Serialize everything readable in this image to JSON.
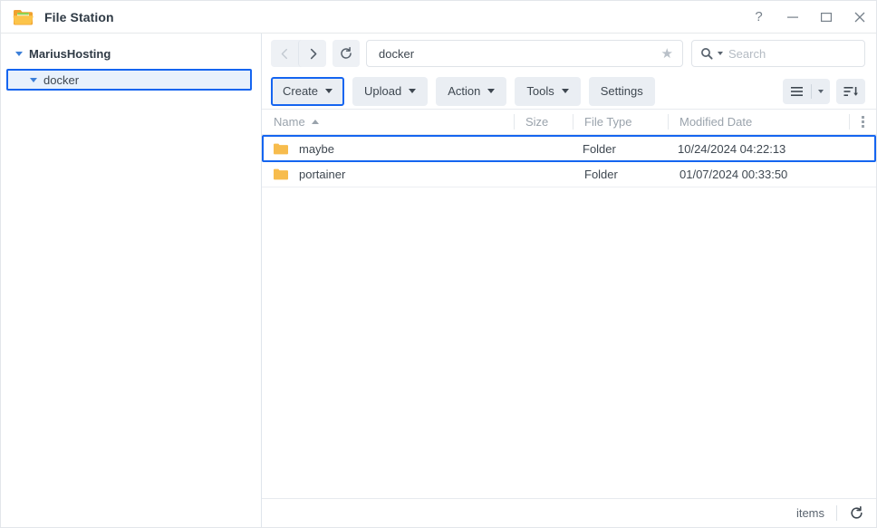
{
  "window": {
    "title": "File Station",
    "app_icon": "folder-icon",
    "controls": {
      "help": "?",
      "minimize": "minimize-icon",
      "maximize": "maximize-icon",
      "close": "close-icon"
    }
  },
  "sidebar": {
    "root": {
      "label": "MariusHosting",
      "expanded": true
    },
    "items": [
      {
        "label": "docker",
        "expanded": true,
        "selected": true
      }
    ]
  },
  "nav": {
    "back": "back-icon",
    "forward": "forward-icon",
    "refresh": "refresh-icon",
    "back_disabled": true,
    "address_value": "docker",
    "address_placeholder": "",
    "favorite_icon": "star-icon"
  },
  "search": {
    "placeholder": "Search",
    "value": "",
    "icon": "search-icon"
  },
  "toolbar": {
    "buttons": [
      {
        "label": "Create",
        "dropdown": true,
        "focused": true
      },
      {
        "label": "Upload",
        "dropdown": true,
        "focused": false
      },
      {
        "label": "Action",
        "dropdown": true,
        "focused": false
      },
      {
        "label": "Tools",
        "dropdown": true,
        "focused": false
      },
      {
        "label": "Settings",
        "dropdown": false,
        "focused": false
      }
    ],
    "view_button": "list-view-icon",
    "view_dropdown": "chevron-down-icon",
    "sort_button": "sort-descending-icon"
  },
  "table": {
    "columns": [
      {
        "key": "name",
        "label": "Name",
        "sort": "asc"
      },
      {
        "key": "size",
        "label": "Size"
      },
      {
        "key": "type",
        "label": "File Type"
      },
      {
        "key": "date",
        "label": "Modified Date"
      }
    ],
    "kebab": "column-options-icon",
    "rows": [
      {
        "icon": "folder-icon",
        "name": "maybe",
        "size": "",
        "type": "Folder",
        "date": "10/24/2024 04:22:13",
        "selected": true
      },
      {
        "icon": "folder-icon",
        "name": "portainer",
        "size": "",
        "type": "Folder",
        "date": "01/07/2024 00:33:50",
        "selected": false
      }
    ]
  },
  "footer": {
    "items_label": "items",
    "refresh_icon": "refresh-icon"
  },
  "colors": {
    "accent": "#1565f0",
    "folder": "#f7bc4d",
    "selection_bg": "#e8f1fc",
    "text": "#3e4750",
    "muted": "#9aa3ac"
  }
}
